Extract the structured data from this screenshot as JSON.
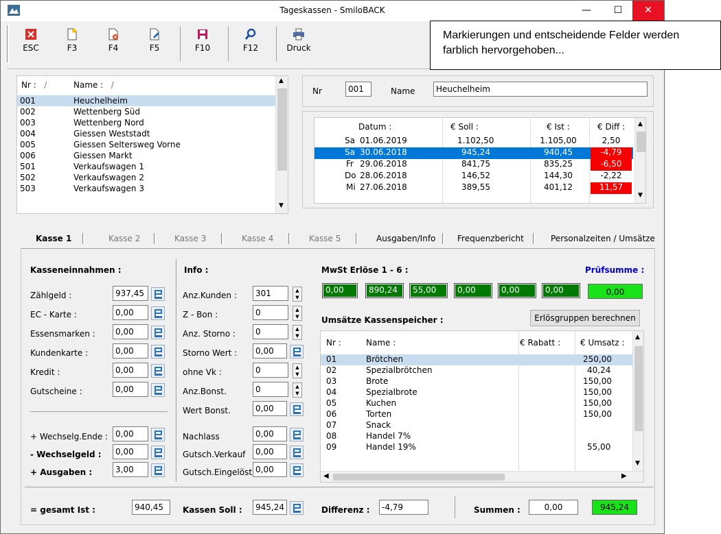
{
  "window": {
    "title": "Tageskassen - SmiloBACK",
    "close": "✕",
    "minimize": "—",
    "maximize": "☐"
  },
  "callout": "Markierungen und entscheidende Felder werden farblich hervorgehoben...",
  "toolbar": [
    {
      "label": "ESC"
    },
    {
      "label": "F3"
    },
    {
      "label": "F4"
    },
    {
      "label": "F5"
    },
    {
      "label": "F10"
    },
    {
      "label": "F12"
    },
    {
      "label": "Druck"
    }
  ],
  "stores": {
    "col_nr": "Nr :",
    "col_name": "Name :",
    "sort_mark": "/",
    "rows": [
      {
        "nr": "001",
        "name": "Heuchelheim"
      },
      {
        "nr": "002",
        "name": "Wettenberg Süd"
      },
      {
        "nr": "003",
        "name": "Wettenberg Nord"
      },
      {
        "nr": "004",
        "name": "Giessen Weststadt"
      },
      {
        "nr": "005",
        "name": "Giessen Seltersweg Vorne"
      },
      {
        "nr": "006",
        "name": "Giessen Markt"
      },
      {
        "nr": "501",
        "name": "Verkaufswagen 1"
      },
      {
        "nr": "502",
        "name": "Verkaufswagen 2"
      },
      {
        "nr": "503",
        "name": "Verkaufswagen 3"
      }
    ]
  },
  "detail": {
    "nr_label": "Nr",
    "nr_value": "001",
    "name_label": "Name",
    "name_value": "Heuchelheim"
  },
  "days": {
    "headers": [
      "Datum :",
      "€ Soll :",
      "€ Ist :",
      "€ Diff :"
    ],
    "rows": [
      {
        "day": "Sa",
        "date": "01.06.2019",
        "soll": "1.102,50",
        "ist": "1.105,00",
        "diff": "2,50"
      },
      {
        "day": "Sa",
        "date": "30.06.2018",
        "soll": "945,24",
        "ist": "940,45",
        "diff": "-4,79"
      },
      {
        "day": "Fr",
        "date": "29.06.2018",
        "soll": "841,75",
        "ist": "835,25",
        "diff": "-6,50"
      },
      {
        "day": "Do",
        "date": "28.06.2018",
        "soll": "146,52",
        "ist": "144,30",
        "diff": "-2,22"
      },
      {
        "day": "Mi",
        "date": "27.06.2018",
        "soll": "389,55",
        "ist": "401,12",
        "diff": "11,57"
      }
    ]
  },
  "tabs": [
    "Kasse 1",
    "Kasse 2",
    "Kasse 3",
    "Kasse 4",
    "Kasse 5",
    "Ausgaben/Info",
    "Frequenzbericht",
    "Personalzeiten / Umsätze"
  ],
  "income": {
    "heading": "Kasseneinnahmen :",
    "rows": [
      {
        "label": "Zählgeld :",
        "value": "937,45"
      },
      {
        "label": "EC - Karte :",
        "value": "0,00"
      },
      {
        "label": "Essensmarken :",
        "value": "0,00"
      },
      {
        "label": "Kundenkarte :",
        "value": "0,00"
      },
      {
        "label": "Kredit :",
        "value": "0,00"
      },
      {
        "label": "Gutscheine :",
        "value": "0,00"
      }
    ],
    "wechsel_ende_label": "+ Wechselg.Ende :",
    "wechsel_ende": "0,00",
    "wechselgeld_label": "- Wechselgeld :",
    "wechselgeld": "0,00",
    "ausgaben_label": "+ Ausgaben :",
    "ausgaben": "3,00",
    "gesamt_label": "= gesamt Ist :",
    "gesamt": "940,45"
  },
  "info": {
    "heading": "Info :",
    "rows": [
      {
        "label": "Anz.Kunden :",
        "value": "301"
      },
      {
        "label": "Z - Bon :",
        "value": "0"
      },
      {
        "label": "Anz. Storno :",
        "value": "0"
      },
      {
        "label": "Storno Wert :",
        "value": "0,00"
      },
      {
        "label": "ohne Vk :",
        "value": "0"
      },
      {
        "label": "Anz.Bonst.",
        "value": "0"
      },
      {
        "label": "Wert Bonst.",
        "value": "0,00"
      },
      {
        "label": "Nachlass",
        "value": "0,00"
      },
      {
        "label": "Gutsch.Verkauf",
        "value": "0,00"
      },
      {
        "label": "Gutsch.Eingelöst",
        "value": "0,00"
      }
    ],
    "soll_label": "Kassen Soll :",
    "soll": "945,24"
  },
  "mwst": {
    "heading": "MwSt Erlöse 1 - 6 :",
    "values": [
      "0,00",
      "890,24",
      "55,00",
      "0,00",
      "0,00",
      "0,00"
    ],
    "pruef_label": "Prüfsumme :",
    "pruef_value": "0,00"
  },
  "umsatz": {
    "heading": "Umsätze Kassenspeicher :",
    "button": "Erlösgruppen berechnen",
    "headers": [
      "Nr :",
      "Name :",
      "€ Rabatt :",
      "€ Umsatz :"
    ],
    "rows": [
      {
        "nr": "01",
        "name": "Brötchen",
        "rabatt": "",
        "umsatz": "250,00"
      },
      {
        "nr": "02",
        "name": "Spezialbrötchen",
        "rabatt": "",
        "umsatz": "40,24"
      },
      {
        "nr": "03",
        "name": "Brote",
        "rabatt": "",
        "umsatz": "150,00"
      },
      {
        "nr": "04",
        "name": "Spezialbrote",
        "rabatt": "",
        "umsatz": "150,00"
      },
      {
        "nr": "05",
        "name": "Kuchen",
        "rabatt": "",
        "umsatz": "150,00"
      },
      {
        "nr": "06",
        "name": "Torten",
        "rabatt": "",
        "umsatz": "150,00"
      },
      {
        "nr": "07",
        "name": "Snack",
        "rabatt": "",
        "umsatz": ""
      },
      {
        "nr": "08",
        "name": "Handel 7%",
        "rabatt": "",
        "umsatz": ""
      },
      {
        "nr": "09",
        "name": "Handel 19%",
        "rabatt": "",
        "umsatz": "55,00"
      }
    ]
  },
  "footer": {
    "diff_label": "Differenz :",
    "diff": "-4,79",
    "summen_label": "Summen :",
    "summen1": "0,00",
    "summen2": "945,24"
  },
  "colors": {
    "highlight_green": "#19e219",
    "dark_green": "#007a00",
    "alert_red": "#f40000",
    "selection_blue": "#0078d7",
    "pruef_blue": "#0000cc"
  }
}
